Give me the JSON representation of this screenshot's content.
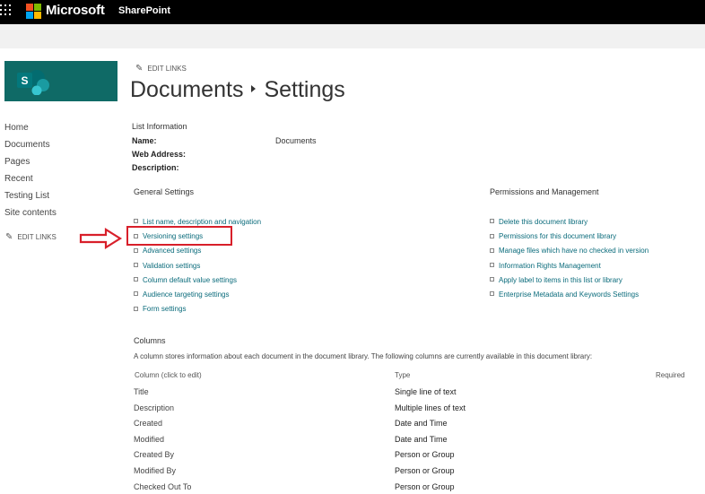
{
  "suite_bar": {
    "brand": "Microsoft",
    "app": "SharePoint"
  },
  "left_nav": {
    "items": [
      "Home",
      "Documents",
      "Pages",
      "Recent",
      "Testing List",
      "Site contents"
    ],
    "edit_links": "EDIT LINKS"
  },
  "header": {
    "edit_links": "EDIT LINKS",
    "breadcrumb_root": "Documents",
    "breadcrumb_current": "Settings"
  },
  "list_info": {
    "heading": "List Information",
    "name_label": "Name:",
    "name_value": "Documents",
    "web_address_label": "Web Address:",
    "description_label": "Description:"
  },
  "general_settings": {
    "heading": "General Settings",
    "links": [
      "List name, description and navigation",
      "Versioning settings",
      "Advanced settings",
      "Validation settings",
      "Column default value settings",
      "Audience targeting settings",
      "Form settings"
    ]
  },
  "permissions": {
    "heading": "Permissions and Management",
    "links": [
      "Delete this document library",
      "Permissions for this document library",
      "Manage files which have no checked in version",
      "Information Rights Management",
      "Apply label to items in this list or library",
      "Enterprise Metadata and Keywords Settings"
    ]
  },
  "columns": {
    "heading": "Columns",
    "description": "A column stores information about each document in the document library. The following columns are currently available in this document library:",
    "header_column": "Column (click to edit)",
    "header_type": "Type",
    "header_required": "Required",
    "rows": [
      {
        "name": "Title",
        "type": "Single line of text"
      },
      {
        "name": "Description",
        "type": "Multiple lines of text"
      },
      {
        "name": "Created",
        "type": "Date and Time"
      },
      {
        "name": "Modified",
        "type": "Date and Time"
      },
      {
        "name": "Created By",
        "type": "Person or Group"
      },
      {
        "name": "Modified By",
        "type": "Person or Group"
      },
      {
        "name": "Checked Out To",
        "type": "Person or Group"
      }
    ]
  },
  "colors": {
    "suite_bar": "#000000",
    "site_logo": "#0f6a66",
    "link": "#0a6b7b",
    "annotation": "#d81f2a"
  },
  "icons": [
    "waffle-icon",
    "microsoft-logo-icon",
    "sharepoint-icon",
    "pencil-icon",
    "red-arrow-icon"
  ]
}
